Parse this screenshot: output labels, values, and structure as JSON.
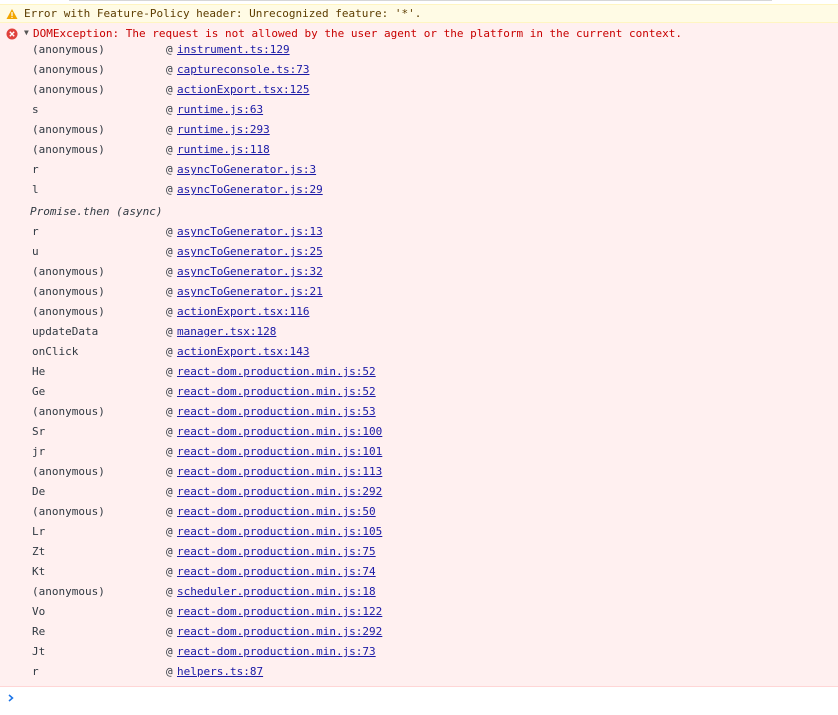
{
  "warning": {
    "text": "Error with Feature-Policy header: Unrecognized feature: '*'.",
    "icon": "warning-triangle-icon"
  },
  "error": {
    "icon": "error-circle-icon",
    "expand_icon": "expand-triangle-icon",
    "message": "DOMException: The request is not allowed by the user agent or the platform in the current context."
  },
  "stack": [
    {
      "fn": "(anonymous)",
      "loc": "instrument.ts:129"
    },
    {
      "fn": "(anonymous)",
      "loc": "captureconsole.ts:73"
    },
    {
      "fn": "(anonymous)",
      "loc": "actionExport.tsx:125"
    },
    {
      "fn": "s",
      "loc": "runtime.js:63"
    },
    {
      "fn": "(anonymous)",
      "loc": "runtime.js:293"
    },
    {
      "fn": "(anonymous)",
      "loc": "runtime.js:118"
    },
    {
      "fn": "r",
      "loc": "asyncToGenerator.js:3"
    },
    {
      "fn": "l",
      "loc": "asyncToGenerator.js:29"
    },
    {
      "async": "Promise.then (async)"
    },
    {
      "fn": "r",
      "loc": "asyncToGenerator.js:13"
    },
    {
      "fn": "u",
      "loc": "asyncToGenerator.js:25"
    },
    {
      "fn": "(anonymous)",
      "loc": "asyncToGenerator.js:32"
    },
    {
      "fn": "(anonymous)",
      "loc": "asyncToGenerator.js:21"
    },
    {
      "fn": "(anonymous)",
      "loc": "actionExport.tsx:116"
    },
    {
      "fn": "updateData",
      "loc": "manager.tsx:128"
    },
    {
      "fn": "onClick",
      "loc": "actionExport.tsx:143"
    },
    {
      "fn": "He",
      "loc": "react-dom.production.min.js:52"
    },
    {
      "fn": "Ge",
      "loc": "react-dom.production.min.js:52"
    },
    {
      "fn": "(anonymous)",
      "loc": "react-dom.production.min.js:53"
    },
    {
      "fn": "Sr",
      "loc": "react-dom.production.min.js:100"
    },
    {
      "fn": "jr",
      "loc": "react-dom.production.min.js:101"
    },
    {
      "fn": "(anonymous)",
      "loc": "react-dom.production.min.js:113"
    },
    {
      "fn": "De",
      "loc": "react-dom.production.min.js:292"
    },
    {
      "fn": "(anonymous)",
      "loc": "react-dom.production.min.js:50"
    },
    {
      "fn": "Lr",
      "loc": "react-dom.production.min.js:105"
    },
    {
      "fn": "Zt",
      "loc": "react-dom.production.min.js:75"
    },
    {
      "fn": "Kt",
      "loc": "react-dom.production.min.js:74"
    },
    {
      "fn": "(anonymous)",
      "loc": "scheduler.production.min.js:18"
    },
    {
      "fn": "Vo",
      "loc": "react-dom.production.min.js:122"
    },
    {
      "fn": "Re",
      "loc": "react-dom.production.min.js:292"
    },
    {
      "fn": "Jt",
      "loc": "react-dom.production.min.js:73"
    },
    {
      "fn": "r",
      "loc": "helpers.ts:87"
    }
  ],
  "at_symbol": "@",
  "prompt": {
    "icon": "prompt-chevron-icon",
    "value": ""
  },
  "colors": {
    "warning_bg": "#fffbe5",
    "error_bg": "#fff0f0",
    "error_text": "#c80000",
    "link": "#1a1aa6"
  }
}
